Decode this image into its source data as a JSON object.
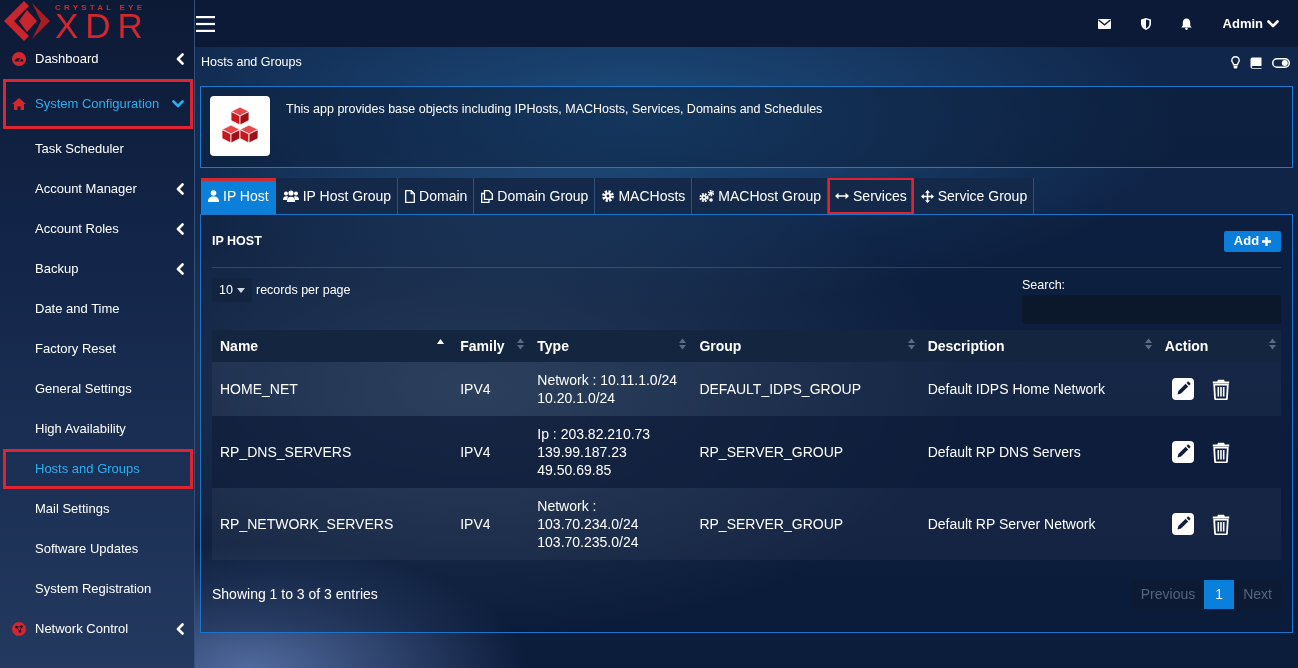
{
  "header": {
    "logo": {
      "tagline": "CRYSTAL EYE",
      "wordmark": "XDR"
    },
    "user_menu": {
      "label": "Admin"
    }
  },
  "sidebar": {
    "items": [
      {
        "label": "Dashboard",
        "kind": "submenu",
        "expanded": false,
        "selected": false,
        "highlighted": false
      },
      {
        "label": "System Configuration",
        "kind": "submenu",
        "expanded": true,
        "selected": true,
        "highlighted": true,
        "children": [
          {
            "label": "Task Scheduler",
            "kind": "link",
            "selected": false,
            "highlighted": false
          },
          {
            "label": "Account Manager",
            "kind": "submenu",
            "expanded": false,
            "selected": false,
            "highlighted": false
          },
          {
            "label": "Account Roles",
            "kind": "submenu",
            "expanded": false,
            "selected": false,
            "highlighted": false
          },
          {
            "label": "Backup",
            "kind": "submenu",
            "expanded": false,
            "selected": false,
            "highlighted": false
          },
          {
            "label": "Date and Time",
            "kind": "link",
            "selected": false,
            "highlighted": false
          },
          {
            "label": "Factory Reset",
            "kind": "link",
            "selected": false,
            "highlighted": false
          },
          {
            "label": "General Settings",
            "kind": "link",
            "selected": false,
            "highlighted": false
          },
          {
            "label": "High Availability",
            "kind": "link",
            "selected": false,
            "highlighted": false
          },
          {
            "label": "Hosts and Groups",
            "kind": "link",
            "selected": true,
            "highlighted": true
          },
          {
            "label": "Mail Settings",
            "kind": "link",
            "selected": false,
            "highlighted": false
          },
          {
            "label": "Software Updates",
            "kind": "link",
            "selected": false,
            "highlighted": false
          },
          {
            "label": "System Registration",
            "kind": "link",
            "selected": false,
            "highlighted": false
          }
        ]
      },
      {
        "label": "Network Control",
        "kind": "submenu",
        "expanded": false,
        "selected": false,
        "highlighted": false
      }
    ]
  },
  "page": {
    "title": "Hosts and Groups"
  },
  "info_panel": {
    "text": "This app provides base objects including IPHosts, MACHosts, Services, Domains and Schedules"
  },
  "tabs": [
    {
      "label": "IP Host",
      "selected": true,
      "highlighted": false
    },
    {
      "label": "IP Host Group",
      "selected": false,
      "highlighted": false
    },
    {
      "label": "Domain",
      "selected": false,
      "highlighted": false
    },
    {
      "label": "Domain Group",
      "selected": false,
      "highlighted": false
    },
    {
      "label": "MACHosts",
      "selected": false,
      "highlighted": false
    },
    {
      "label": "MACHost Group",
      "selected": false,
      "highlighted": false
    },
    {
      "label": "Services",
      "selected": false,
      "highlighted": true
    },
    {
      "label": "Service Group",
      "selected": false,
      "highlighted": false
    }
  ],
  "panel": {
    "title": "IP HOST",
    "add_button": "Add",
    "page_length": {
      "value": "10",
      "label": "records per page"
    },
    "search": {
      "label": "Search:"
    },
    "table": {
      "columns": [
        {
          "label": "Name",
          "sorted": true
        },
        {
          "label": "Family",
          "sorted": false
        },
        {
          "label": "Type",
          "sorted": false
        },
        {
          "label": "Group",
          "sorted": false
        },
        {
          "label": "Description",
          "sorted": false
        },
        {
          "label": "Action",
          "sorted": false
        }
      ],
      "rows": [
        {
          "name": "HOME_NET",
          "family": "IPV4",
          "type": [
            "Network : 10.11.1.0/24",
            "10.20.1.0/24"
          ],
          "group": "DEFAULT_IDPS_GROUP",
          "description": "Default IDPS Home Network"
        },
        {
          "name": "RP_DNS_SERVERS",
          "family": "IPV4",
          "type": [
            "Ip : 203.82.210.73",
            "139.99.187.23",
            "49.50.69.85"
          ],
          "group": "RP_SERVER_GROUP",
          "description": "Default RP DNS Servers"
        },
        {
          "name": "RP_NETWORK_SERVERS",
          "family": "IPV4",
          "type": [
            "Network :",
            "103.70.234.0/24",
            "103.70.235.0/24"
          ],
          "group": "RP_SERVER_GROUP",
          "description": "Default RP Server Network"
        }
      ]
    },
    "info": "Showing 1 to 3 of 3 entries",
    "pagination": {
      "previous": {
        "label": "Previous",
        "disabled": true
      },
      "pages": [
        {
          "label": "1",
          "selected": true
        }
      ],
      "next": {
        "label": "Next",
        "disabled": true
      }
    }
  }
}
